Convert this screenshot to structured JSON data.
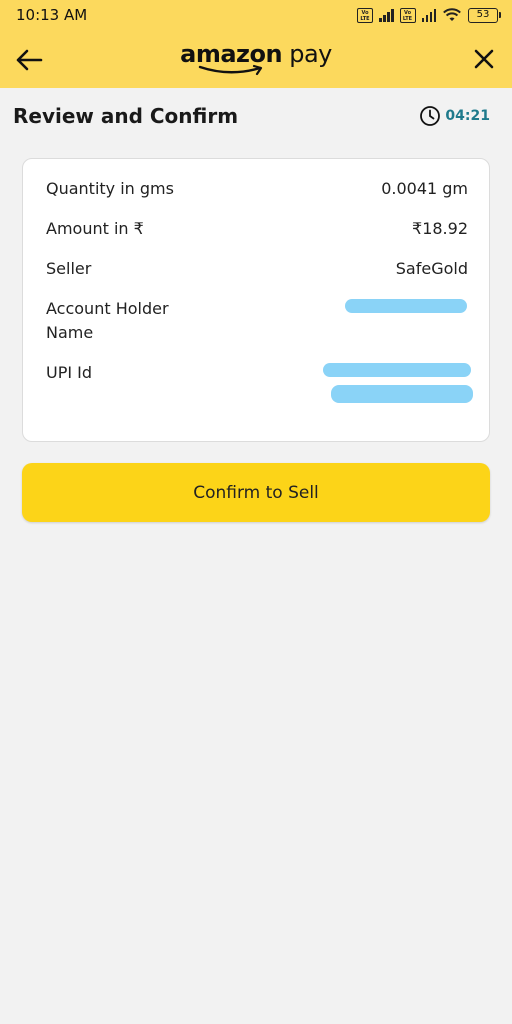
{
  "status_bar": {
    "time": "10:13 AM",
    "network_badge": "Vo LTE",
    "battery": "53"
  },
  "header": {
    "brand_bold": "amazon",
    "brand_light": " pay",
    "back_icon": "arrow-left-icon",
    "close_icon": "close-icon"
  },
  "page": {
    "title": "Review and Confirm",
    "timer": "04:21"
  },
  "details": {
    "quantity_label": "Quantity in gms",
    "quantity_value": "0.0041 gm",
    "amount_label": "Amount in ₹",
    "amount_value": "₹18.92",
    "seller_label": "Seller",
    "seller_value": "SafeGold",
    "account_holder_label": "Account Holder Name",
    "upi_label": "UPI Id"
  },
  "actions": {
    "confirm_label": "Confirm to Sell"
  },
  "colors": {
    "header_bg": "#fcd95d",
    "button_bg": "#fcd418",
    "timer_text": "#1f7a8c",
    "redaction": "#8ad3f7"
  }
}
